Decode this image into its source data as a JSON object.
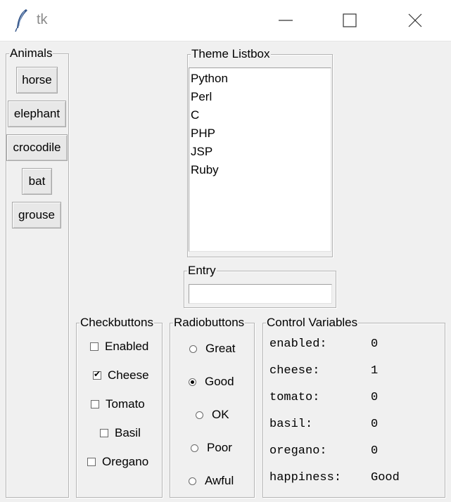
{
  "window": {
    "title": "tk"
  },
  "animals": {
    "legend": "Animals",
    "buttons": [
      "horse",
      "elephant",
      "crocodile",
      "bat",
      "grouse"
    ]
  },
  "theme_listbox": {
    "legend": "Theme Listbox",
    "items": [
      "Python",
      "Perl",
      "C",
      "PHP",
      "JSP",
      "Ruby"
    ]
  },
  "entry": {
    "legend": "Entry",
    "value": ""
  },
  "checkbuttons": {
    "legend": "Checkbuttons",
    "items": [
      {
        "label": "Enabled",
        "checked": false
      },
      {
        "label": "Cheese",
        "checked": true
      },
      {
        "label": "Tomato",
        "checked": false
      },
      {
        "label": "Basil",
        "checked": false
      },
      {
        "label": "Oregano",
        "checked": false
      }
    ]
  },
  "radiobuttons": {
    "legend": "Radiobuttons",
    "items": [
      {
        "label": "Great",
        "selected": false
      },
      {
        "label": "Good",
        "selected": true
      },
      {
        "label": "OK",
        "selected": false
      },
      {
        "label": "Poor",
        "selected": false
      },
      {
        "label": "Awful",
        "selected": false
      }
    ]
  },
  "control_variables": {
    "legend": "Control Variables",
    "rows": [
      {
        "key": "enabled:",
        "value": "0"
      },
      {
        "key": "cheese:",
        "value": "1"
      },
      {
        "key": "tomato:",
        "value": "0"
      },
      {
        "key": "basil:",
        "value": "0"
      },
      {
        "key": "oregano:",
        "value": "0"
      },
      {
        "key": "happiness:",
        "value": "Good"
      }
    ]
  }
}
